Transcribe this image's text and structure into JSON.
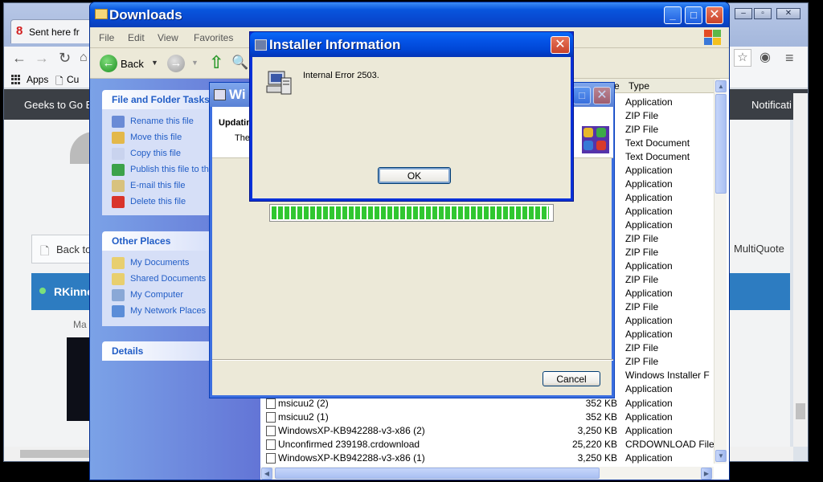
{
  "chrome": {
    "tab_title": "Sent here fr",
    "bookmarks": {
      "apps": "Apps",
      "second": "Cu"
    },
    "site_title": "Geeks to Go E",
    "notifications": "Notificati",
    "back_button": "Back to",
    "multiquote": "MultiQuote",
    "user_name": "RKinne",
    "member_label": "Ma"
  },
  "explorer": {
    "title": "Downloads",
    "menu": [
      "File",
      "Edit",
      "View",
      "Favorites"
    ],
    "toolbar": {
      "back": "Back"
    },
    "file_tasks": {
      "header": "File and Folder Tasks",
      "items": [
        {
          "label": "Rename this file",
          "icon": "rename-icon",
          "color": "#6a8bd6"
        },
        {
          "label": "Move this file",
          "icon": "move-icon",
          "color": "#e3b84a"
        },
        {
          "label": "Copy this file",
          "icon": "copy-icon",
          "color": "#c9d3ee"
        },
        {
          "label": "Publish this file to th",
          "icon": "publish-icon",
          "color": "#3ca24a"
        },
        {
          "label": "E-mail this file",
          "icon": "email-icon",
          "color": "#d8c27e"
        },
        {
          "label": "Delete this file",
          "icon": "delete-icon",
          "color": "#d9342b"
        }
      ]
    },
    "other_places": {
      "header": "Other Places",
      "items": [
        {
          "label": "My Documents",
          "icon": "my-documents-icon",
          "color": "#e8cf6f"
        },
        {
          "label": "Shared Documents",
          "icon": "shared-documents-icon",
          "color": "#e8cf6f"
        },
        {
          "label": "My Computer",
          "icon": "my-computer-icon",
          "color": "#8aa8d6"
        },
        {
          "label": "My Network Places",
          "icon": "network-places-icon",
          "color": "#5b8dd8"
        }
      ]
    },
    "details": {
      "header": "Details"
    },
    "list": {
      "header_type": "Type",
      "header_e": "e",
      "types_upper": [
        "Application",
        "ZIP File",
        "ZIP File",
        "Text Document",
        "Text Document",
        "Application",
        "Application",
        "Application",
        "Application",
        "Application",
        "ZIP File",
        "ZIP File",
        "Application",
        "ZIP File",
        "Application",
        "ZIP File",
        "Application",
        "Application",
        "ZIP File",
        "ZIP File",
        "Windows Installer F",
        "Application"
      ],
      "rows": [
        {
          "name": "msicuu2 (2)",
          "size": "352 KB",
          "type": "Application"
        },
        {
          "name": "msicuu2 (1)",
          "size": "352 KB",
          "type": "Application"
        },
        {
          "name": "WindowsXP-KB942288-v3-x86 (2)",
          "size": "3,250 KB",
          "type": "Application"
        },
        {
          "name": "Unconfirmed 239198.crdownload",
          "size": "25,220 KB",
          "type": "CRDOWNLOAD File"
        },
        {
          "name": "WindowsXP-KB942288-v3-x86 (1)",
          "size": "3,250 KB",
          "type": "Application"
        }
      ]
    }
  },
  "installer": {
    "title": "Wi",
    "header_bold": "Updatin",
    "header_sub": "The",
    "progress": 0.99,
    "cancel": "Cancel"
  },
  "error_dialog": {
    "title": "Installer Information",
    "message": "Internal Error 2503.",
    "ok": "OK"
  },
  "colors": {
    "xp_blue": "#0453e6",
    "task_link": "#215dc6",
    "progress_green": "#30c730"
  }
}
